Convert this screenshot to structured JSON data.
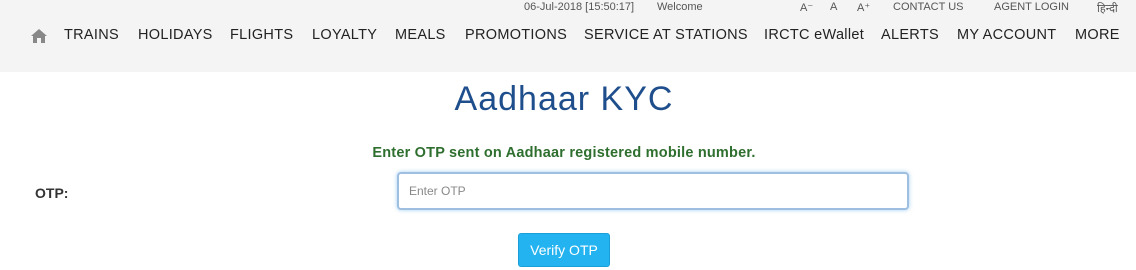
{
  "topbar": {
    "datetime": "06-Jul-2018 [15:50:17]",
    "welcome": "Welcome",
    "font_decrease": "A⁻",
    "font_normal": "A",
    "font_increase": "A⁺",
    "contact_us": "CONTACT US",
    "agent_login": "AGENT LOGIN",
    "language": "हिन्दी"
  },
  "nav": {
    "home_icon": "home-icon",
    "items": [
      "TRAINS",
      "HOLIDAYS",
      "FLIGHTS",
      "LOYALTY",
      "MEALS",
      "PROMOTIONS",
      "SERVICE AT STATIONS",
      "IRCTC eWallet",
      "ALERTS",
      "MY ACCOUNT",
      "MORE"
    ]
  },
  "main": {
    "title": "Aadhaar KYC",
    "message": "Enter OTP sent on Aadhaar registered mobile number.",
    "otp_label": "OTP:",
    "otp_placeholder": "Enter OTP",
    "otp_value": "",
    "verify_button": "Verify OTP"
  },
  "colors": {
    "title": "#1f4e8c",
    "message": "#2e6e2e",
    "button": "#23b3f0",
    "header_bg": "#f4f4f4"
  }
}
